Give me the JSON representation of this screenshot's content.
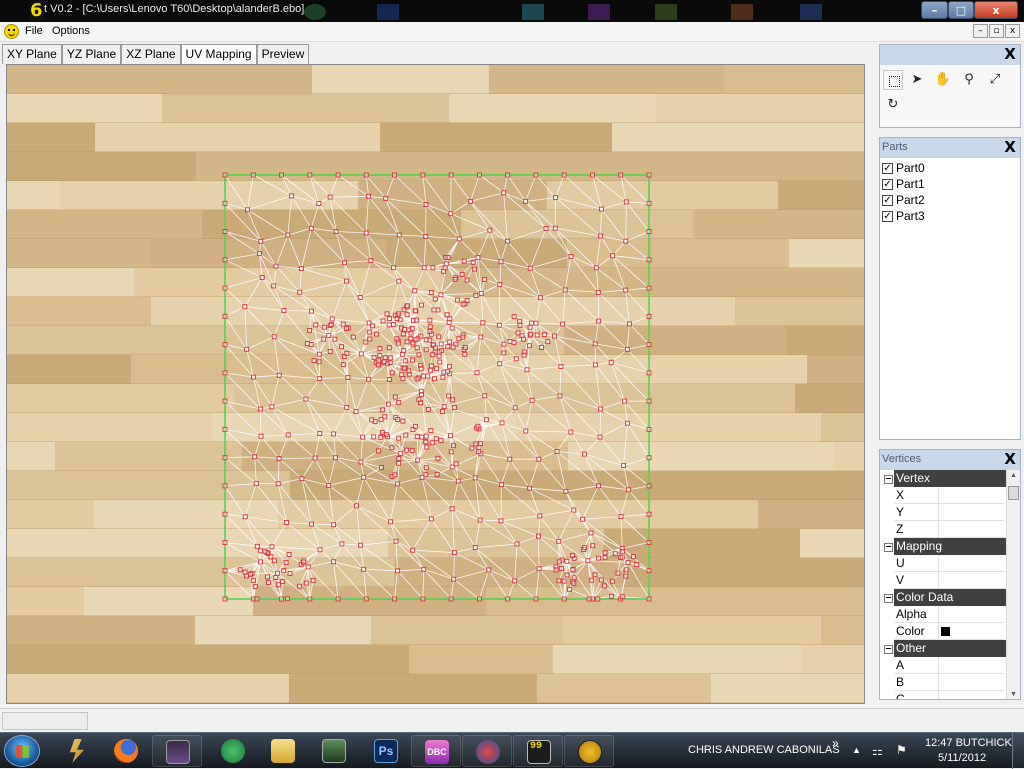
{
  "window": {
    "app_icon_glyph": "6",
    "title": "t V0.2 - [C:\\Users\\Lenovo T60\\Desktop\\alanderB.ebo]",
    "controls": {
      "minimize": "–",
      "maximize": "□",
      "close": "x"
    }
  },
  "menu": {
    "items": [
      "File",
      "Options"
    ],
    "mdi_controls": [
      "–",
      "▫",
      "x"
    ]
  },
  "tabs": [
    {
      "label": "XY Plane"
    },
    {
      "label": "YZ Plane"
    },
    {
      "label": "XZ Plane"
    },
    {
      "label": "UV Mapping",
      "active": true
    },
    {
      "label": "Preview"
    }
  ],
  "tools": {
    "close": "X",
    "icons": [
      "select-rect-icon",
      "move-vertex-icon",
      "hand-pan-icon",
      "zoom-icon",
      "resize-icon",
      "rotate-icon"
    ]
  },
  "parts_panel": {
    "title": "Parts",
    "close": "X",
    "items": [
      {
        "label": "Part0",
        "checked": true
      },
      {
        "label": "Part1",
        "checked": true
      },
      {
        "label": "Part2",
        "checked": true
      },
      {
        "label": "Part3",
        "checked": true
      }
    ]
  },
  "vertices_panel": {
    "title": "Vertices",
    "close": "X",
    "groups": {
      "vertex": {
        "label": "Vertex",
        "x": "X",
        "y": "Y",
        "z": "Z"
      },
      "mapping": {
        "label": "Mapping",
        "u": "U",
        "v": "V"
      },
      "color_data": {
        "label": "Color Data",
        "alpha": "Alpha",
        "color": "Color",
        "color_value": "#000000"
      },
      "other": {
        "label": "Other",
        "a": "A",
        "b": "B",
        "c": "C"
      }
    }
  },
  "colors": {
    "uv_border": "#4fd24f",
    "mesh_edges": "#ffffff",
    "vertex_markers": "#d8343a",
    "wood_light": "#e2cba3",
    "wood_dark": "#c7a97c"
  },
  "taskbar": {
    "user_name": "CHRIS ANDREW CABONILAS",
    "overflow": "»",
    "tray_up": "▲",
    "time": "12:47 BUTCHICK",
    "date": "5/11/2012",
    "apps": [
      "winamp-icon",
      "firefox-icon",
      "game-icon",
      "network-icon",
      "explorer-icon",
      "terminal-icon",
      "photoshop-icon",
      "dbc-icon",
      "browser-icon",
      "counter-icon",
      "basketball-icon"
    ],
    "app_labels": {
      "photoshop": "Ps",
      "dbc": "DBC",
      "counter": "99"
    }
  }
}
